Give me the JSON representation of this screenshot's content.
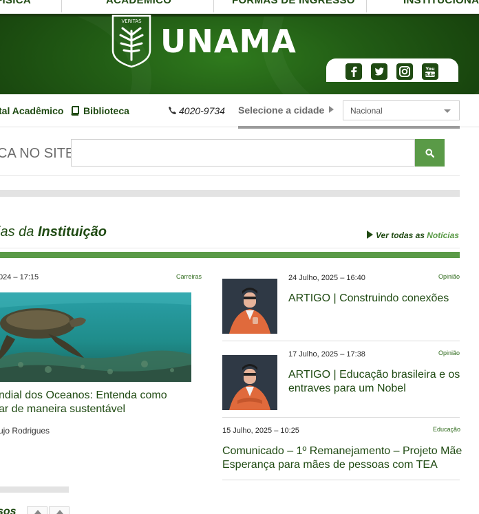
{
  "top_nav": {
    "items": [
      "FÍSICA",
      "ACADÊMICO",
      "FORMAS DE INGRESSO",
      "INSTITUCIONAL"
    ]
  },
  "header": {
    "logo_motto": "VERITAS",
    "logo_text": "UNAMA",
    "social": [
      "facebook-icon",
      "twitter-icon",
      "instagram-icon",
      "youtube-icon"
    ],
    "youtube_text": "You Tube"
  },
  "subbar": {
    "portal_link": "tal Acadêmico",
    "library_link": "Biblioteca",
    "phone": "4020-9734",
    "city_label": "Selecione a cidade",
    "city_value": "Nacional"
  },
  "search": {
    "label": "CA NO SITE",
    "placeholder": ""
  },
  "news": {
    "title_prefix": "ias da",
    "title_bold": "Instituição",
    "see_all_prefix": "Ver todas as",
    "see_all_link": "Notícias",
    "featured": {
      "date": "024 – 17:15",
      "category": "Carreiras",
      "headline_1": "ndial dos Oceanos: Entenda como",
      "headline_2": "ar de maneira sustentável",
      "author": "ujo Rodrigues"
    },
    "items": [
      {
        "date": "24 Julho, 2025 – 16:40",
        "category": "Opinião",
        "headline": "ARTIGO | Construindo conexões"
      },
      {
        "date": "17 Julho, 2025 – 17:38",
        "category": "Opinião",
        "headline": "ARTIGO | Educação brasileira e os entraves para um Nobel"
      },
      {
        "date": "15 Julho, 2025 – 10:25",
        "category": "Educação",
        "headline": "Comunicado – 1º Remanejamento – Projeto Mãe Esperança para mães de pessoas com TEA"
      }
    ]
  },
  "pager": {
    "label": "sos"
  }
}
